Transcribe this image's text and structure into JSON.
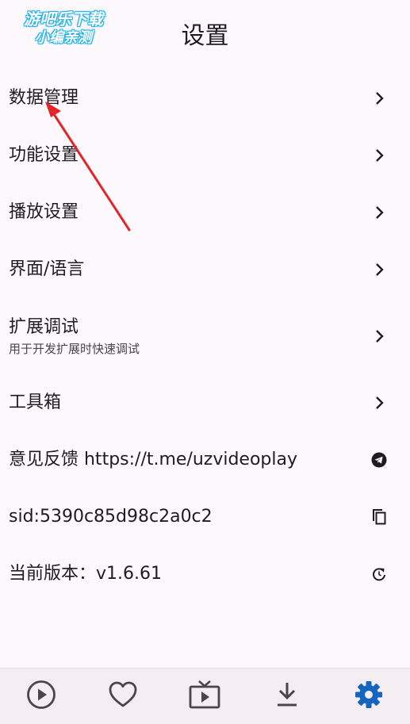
{
  "watermark": {
    "line1": "游吧乐下载",
    "line2": "小编亲测"
  },
  "page": {
    "title": "设置"
  },
  "settings": {
    "items": [
      {
        "label": "数据管理",
        "icon": "chevron-right-icon"
      },
      {
        "label": "功能设置",
        "icon": "chevron-right-icon"
      },
      {
        "label": "播放设置",
        "icon": "chevron-right-icon"
      },
      {
        "label": "界面/语言",
        "icon": "chevron-right-icon"
      },
      {
        "label": "扩展调试",
        "subtitle": "用于开发扩展时快速调试",
        "icon": "chevron-right-icon"
      },
      {
        "label": "工具箱",
        "icon": "chevron-right-icon"
      },
      {
        "label": "意见反馈 https://t.me/uzvideoplay",
        "icon": "telegram-icon"
      },
      {
        "label": "sid:5390c85d98c2a0c2",
        "icon": "copy-icon"
      },
      {
        "label": "当前版本：v1.6.61",
        "icon": "refresh-icon"
      }
    ]
  },
  "bottom_nav": {
    "tabs": [
      {
        "name": "play",
        "icon": "play-circle-icon",
        "active": false
      },
      {
        "name": "favorites",
        "icon": "heart-icon",
        "active": false
      },
      {
        "name": "tv",
        "icon": "tv-icon",
        "active": false
      },
      {
        "name": "download",
        "icon": "download-icon",
        "active": false
      },
      {
        "name": "settings",
        "icon": "gear-icon",
        "active": true
      }
    ]
  },
  "colors": {
    "background": "#fcf8fb",
    "text": "#1f1b1f",
    "subtext": "#4a454a",
    "nav_background": "#f4eef3",
    "nav_icon": "#4a454a",
    "nav_active": "#1565c0",
    "annotation_arrow": "#e0262b",
    "watermark_outline": "#1fb0e8"
  }
}
